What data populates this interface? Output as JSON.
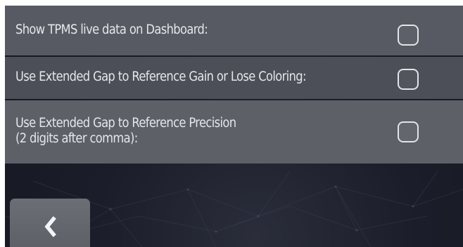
{
  "settings": [
    {
      "label": "Show TPMS live data on Dashboard:",
      "checked": false
    },
    {
      "label": "Use Extended Gap to Reference Gain or Lose Coloring:",
      "checked": false
    },
    {
      "label": "Use Extended Gap to Reference Precision\n(2 digits after comma):",
      "checked": false
    }
  ],
  "icons": {
    "back": "chevron-left-icon",
    "checkbox": "checkbox-unchecked"
  },
  "colors": {
    "row_bg_1": "#585a63",
    "row_bg_2": "#4d4f58",
    "row_bg_3": "#5e6068",
    "text": "#e6e7ea",
    "background": "#1b1e2a"
  }
}
